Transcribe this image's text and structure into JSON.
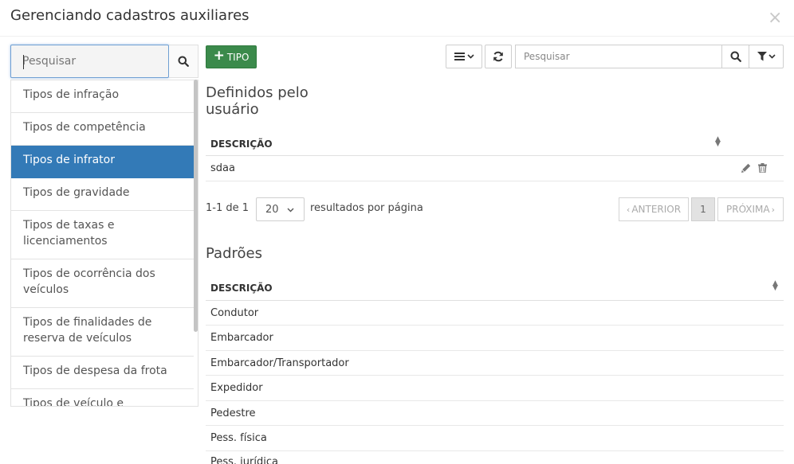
{
  "modal": {
    "title": "Gerenciando cadastros auxiliares",
    "close_icon": "×"
  },
  "sidebar": {
    "search_placeholder": "Pesquisar",
    "items": [
      {
        "label": "Tipos de infração",
        "active": false
      },
      {
        "label": "Tipos de competência",
        "active": false
      },
      {
        "label": "Tipos de infrator",
        "active": true
      },
      {
        "label": "Tipos de gravidade",
        "active": false
      },
      {
        "label": "Tipos de taxas e licenciamentos",
        "active": false
      },
      {
        "label": "Tipos de ocorrência dos veículos",
        "active": false
      },
      {
        "label": "Tipos de finalidades de reserva de veículos",
        "active": false
      },
      {
        "label": "Tipos de despesa da frota",
        "active": false
      },
      {
        "label": "Tipos de veículo e",
        "active": false
      }
    ]
  },
  "toolbar": {
    "add_label": "TIPO",
    "search_placeholder": "Pesquisar"
  },
  "user_defined": {
    "title": "Definidos pelo usuário",
    "column": "DESCRIÇÃO",
    "rows": [
      "sdaa"
    ]
  },
  "pagination": {
    "range_text": "1-1 de 1",
    "page_size": "20",
    "per_page_label": "resultados por página",
    "prev_label": "ANTERIOR",
    "current_page": "1",
    "next_label": "PRÓXIMA"
  },
  "defaults": {
    "title": "Padrões",
    "column": "DESCRIÇÃO",
    "rows": [
      "Condutor",
      "Embarcador",
      "Embarcador/Transportador",
      "Expedidor",
      "Pedestre",
      "Pess. física",
      "Pess. jurídica"
    ]
  },
  "colors": {
    "primary": "#337ab7",
    "success": "#3b8a4b"
  }
}
